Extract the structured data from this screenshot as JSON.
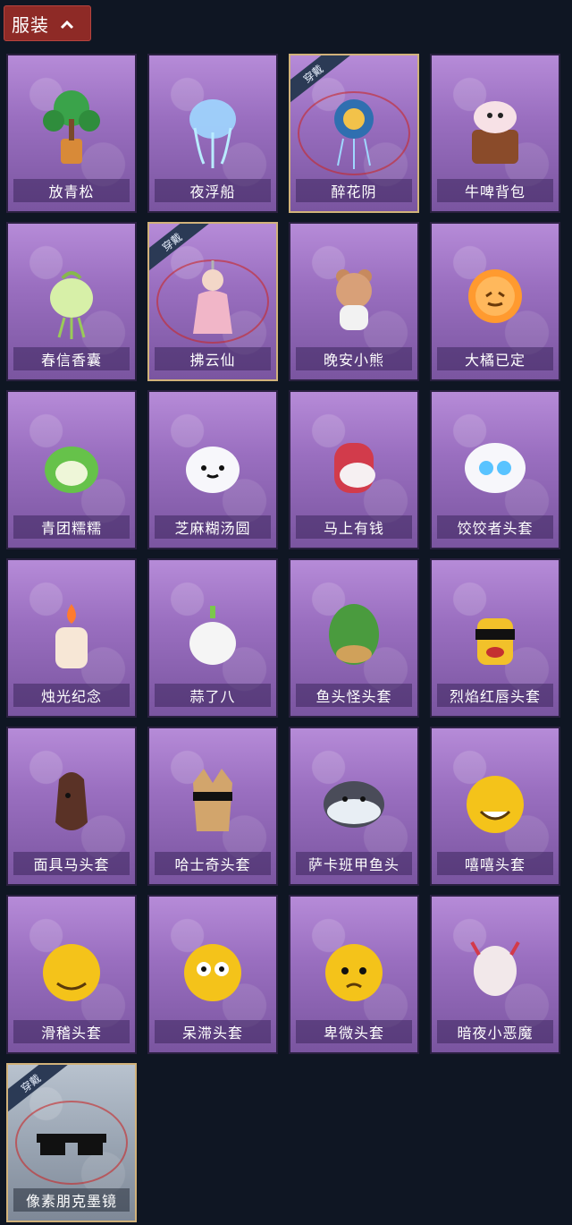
{
  "header": {
    "label": "服装"
  },
  "items": [
    {
      "name": "放青松",
      "worn": false,
      "icon": "pine-bonsai-icon",
      "bg": "purple"
    },
    {
      "name": "夜浮船",
      "worn": false,
      "icon": "jellyfish-lantern-icon",
      "bg": "purple"
    },
    {
      "name": "醉花阴",
      "worn": true,
      "icon": "flower-charm-icon",
      "bg": "purple"
    },
    {
      "name": "牛啤背包",
      "worn": false,
      "icon": "cow-barrel-icon",
      "bg": "purple"
    },
    {
      "name": "春信香囊",
      "worn": false,
      "icon": "sachet-icon",
      "bg": "purple"
    },
    {
      "name": "拂云仙",
      "worn": true,
      "icon": "fairy-doll-icon",
      "bg": "purple"
    },
    {
      "name": "晚安小熊",
      "worn": false,
      "icon": "teddy-bear-icon",
      "bg": "purple"
    },
    {
      "name": "大橘已定",
      "worn": false,
      "icon": "orange-slice-icon",
      "bg": "purple"
    },
    {
      "name": "青团糯糯",
      "worn": false,
      "icon": "green-dumpling-icon",
      "bg": "purple"
    },
    {
      "name": "芝麻糊汤圆",
      "worn": false,
      "icon": "rice-ball-icon",
      "bg": "purple"
    },
    {
      "name": "马上有钱",
      "worn": false,
      "icon": "red-horse-icon",
      "bg": "purple"
    },
    {
      "name": "饺饺者头套",
      "worn": false,
      "icon": "dumpling-head-icon",
      "bg": "purple"
    },
    {
      "name": "烛光纪念",
      "worn": false,
      "icon": "candle-icon",
      "bg": "purple"
    },
    {
      "name": "蒜了八",
      "worn": false,
      "icon": "garlic-icon",
      "bg": "purple"
    },
    {
      "name": "鱼头怪头套",
      "worn": false,
      "icon": "fish-head-icon",
      "bg": "purple"
    },
    {
      "name": "烈焰红唇头套",
      "worn": false,
      "icon": "yellow-mask-sunglasses-icon",
      "bg": "purple"
    },
    {
      "name": "面具马头套",
      "worn": false,
      "icon": "horse-mask-icon",
      "bg": "purple"
    },
    {
      "name": "哈士奇头套",
      "worn": false,
      "icon": "husky-mask-icon",
      "bg": "purple"
    },
    {
      "name": "萨卡班甲鱼头",
      "worn": false,
      "icon": "fish-blob-icon",
      "bg": "purple"
    },
    {
      "name": "嘻嘻头套",
      "worn": false,
      "icon": "grin-emoji-icon",
      "bg": "purple"
    },
    {
      "name": "滑稽头套",
      "worn": false,
      "icon": "smirk-emoji-icon",
      "bg": "purple"
    },
    {
      "name": "呆滞头套",
      "worn": false,
      "icon": "stare-emoji-icon",
      "bg": "purple"
    },
    {
      "name": "卑微头套",
      "worn": false,
      "icon": "pleading-emoji-icon",
      "bg": "purple"
    },
    {
      "name": "暗夜小恶魔",
      "worn": false,
      "icon": "little-devil-icon",
      "bg": "purple"
    },
    {
      "name": "像素朋克墨镜",
      "worn": true,
      "icon": "pixel-sunglasses-icon",
      "bg": "gray"
    }
  ],
  "tag_label": "穿戴"
}
